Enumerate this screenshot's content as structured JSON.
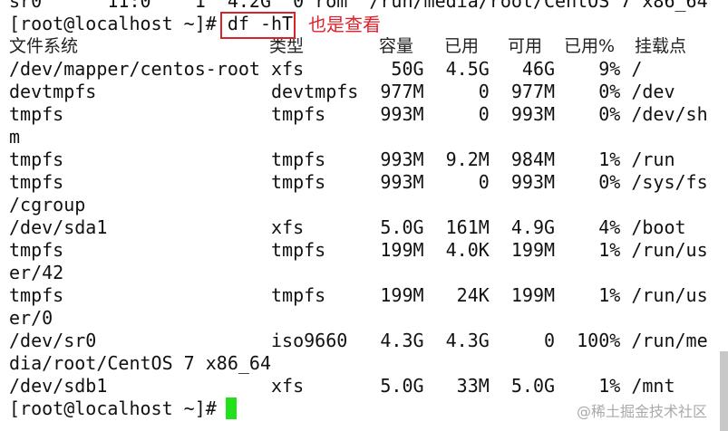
{
  "terminal": {
    "previous_line": "sr0      11:0    1  4.2G  0 rom  /run/media/root/CentOS 7 x86_64",
    "prompt": "[root@localhost ~]# ",
    "command": "df -hT",
    "annotation": "也是查看",
    "final_prompt": "[root@localhost ~]# ",
    "wrap_columns": 64,
    "headers": {
      "filesystem": "文件系统",
      "type": "类型",
      "size": "容量",
      "used": "已用",
      "avail": "可用",
      "use_pct": "已用%",
      "mount": "挂载点"
    },
    "rows": [
      {
        "fs": "/dev/mapper/centos-root",
        "type": "xfs",
        "size": "50G",
        "used": "4.5G",
        "avail": "46G",
        "pct": "9%",
        "mount": "/"
      },
      {
        "fs": "devtmpfs",
        "type": "devtmpfs",
        "size": "977M",
        "used": "0",
        "avail": "977M",
        "pct": "0%",
        "mount": "/dev"
      },
      {
        "fs": "tmpfs",
        "type": "tmpfs",
        "size": "993M",
        "used": "0",
        "avail": "993M",
        "pct": "0%",
        "mount": "/dev/shm"
      },
      {
        "fs": "tmpfs",
        "type": "tmpfs",
        "size": "993M",
        "used": "9.2M",
        "avail": "984M",
        "pct": "1%",
        "mount": "/run"
      },
      {
        "fs": "tmpfs",
        "type": "tmpfs",
        "size": "993M",
        "used": "0",
        "avail": "993M",
        "pct": "0%",
        "mount": "/sys/fs/cgroup"
      },
      {
        "fs": "/dev/sda1",
        "type": "xfs",
        "size": "5.0G",
        "used": "161M",
        "avail": "4.9G",
        "pct": "4%",
        "mount": "/boot"
      },
      {
        "fs": "tmpfs",
        "type": "tmpfs",
        "size": "199M",
        "used": "4.0K",
        "avail": "199M",
        "pct": "1%",
        "mount": "/run/user/42"
      },
      {
        "fs": "tmpfs",
        "type": "tmpfs",
        "size": "199M",
        "used": "24K",
        "avail": "199M",
        "pct": "1%",
        "mount": "/run/user/0"
      },
      {
        "fs": "/dev/sr0",
        "type": "iso9660",
        "size": "4.3G",
        "used": "4.3G",
        "avail": "0",
        "pct": "100%",
        "mount": "/run/media/root/CentOS 7 x86_64"
      },
      {
        "fs": "/dev/sdb1",
        "type": "xfs",
        "size": "5.0G",
        "used": "33M",
        "avail": "5.0G",
        "pct": "1%",
        "mount": "/mnt"
      }
    ]
  },
  "watermark": "@稀土掘金技术社区"
}
